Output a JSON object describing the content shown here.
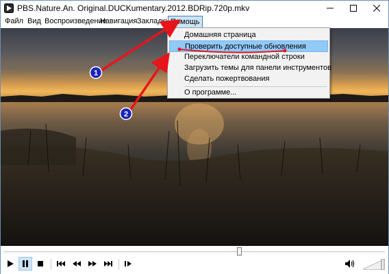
{
  "window": {
    "title": "PBS.Nature.An. Original.DUCKumentary.2012.BDRip.720p.mkv"
  },
  "menubar": {
    "items": [
      "Файл",
      "Вид",
      "Воспроизведение",
      "Навигация",
      "Закладки",
      "Помощь"
    ],
    "active": "Помощь"
  },
  "help_menu": {
    "items": [
      "Домашняя страница",
      "Проверить доступные обновления",
      "Переключатели командной строки",
      "Загрузить темы для панели инструментов",
      "Сделать пожертвования",
      "О программе..."
    ],
    "highlighted_index": 1
  },
  "annotations": {
    "markers": [
      "1",
      "2"
    ],
    "arrow_color": "#e8141c",
    "marker_color": "#1b23b8"
  },
  "playback": {
    "state": "paused",
    "position_fraction": 0.62,
    "volume_fraction": 1.0
  },
  "colors": {
    "menu_highlight": "#91c9f7",
    "menu_bg": "#f2f2f2"
  }
}
